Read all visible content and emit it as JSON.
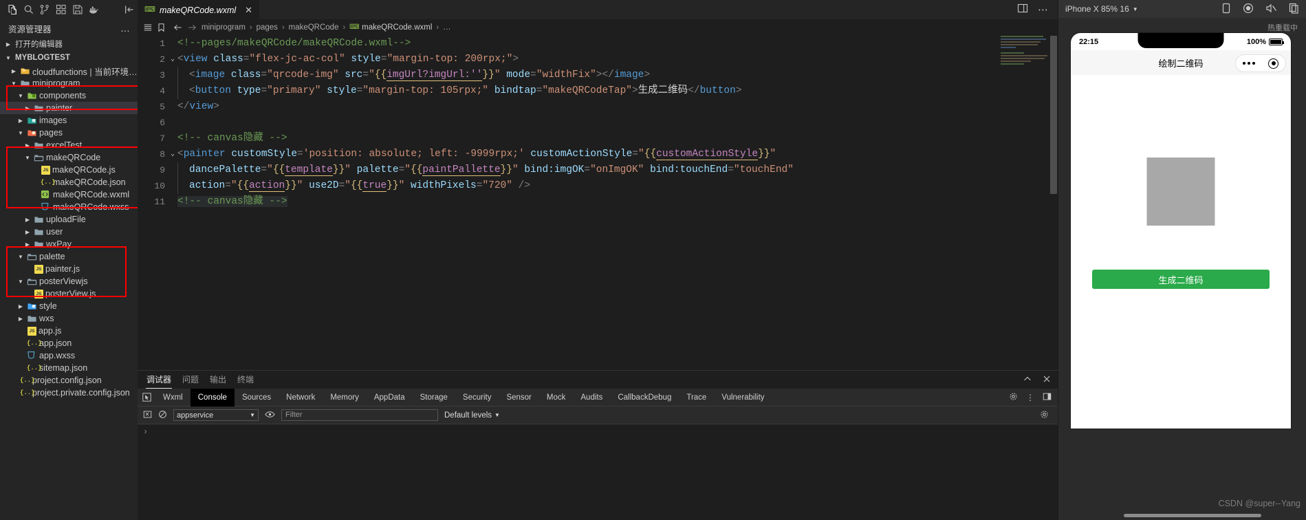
{
  "activity_bar": {
    "icons": [
      "explorer-icon",
      "search-icon",
      "source-control-icon",
      "extensions-icon",
      "save-icon",
      "docker-icon",
      "collapse-icon"
    ]
  },
  "sidebar": {
    "title": "资源管理器",
    "more_label": "…",
    "open_editors_label": "打开的编辑器",
    "project_label": "MYBLOGTEST",
    "tree": [
      {
        "label": "cloudfunctions | 当前环境: blo...",
        "depth": 1,
        "kind": "folder-cloud",
        "twisty": "collapsed"
      },
      {
        "label": "miniprogram",
        "depth": 1,
        "kind": "folder",
        "twisty": "expanded"
      },
      {
        "label": "components",
        "depth": 2,
        "kind": "folder-components",
        "twisty": "expanded"
      },
      {
        "label": "painter",
        "depth": 3,
        "kind": "folder",
        "twisty": "collapsed",
        "selected": true
      },
      {
        "label": "images",
        "depth": 2,
        "kind": "folder-images",
        "twisty": "collapsed"
      },
      {
        "label": "pages",
        "depth": 2,
        "kind": "folder-pages",
        "twisty": "expanded"
      },
      {
        "label": "excelTest",
        "depth": 3,
        "kind": "folder",
        "twisty": "collapsed"
      },
      {
        "label": "makeQRCode",
        "depth": 3,
        "kind": "folder-open",
        "twisty": "expanded"
      },
      {
        "label": "makeQRCode.js",
        "depth": 4,
        "kind": "js",
        "twisty": "none"
      },
      {
        "label": "makeQRCode.json",
        "depth": 4,
        "kind": "json",
        "twisty": "none"
      },
      {
        "label": "makeQRCode.wxml",
        "depth": 4,
        "kind": "wxml",
        "twisty": "none"
      },
      {
        "label": "makeQRCode.wxss",
        "depth": 4,
        "kind": "wxss",
        "twisty": "none"
      },
      {
        "label": "uploadFile",
        "depth": 3,
        "kind": "folder",
        "twisty": "collapsed"
      },
      {
        "label": "user",
        "depth": 3,
        "kind": "folder",
        "twisty": "collapsed"
      },
      {
        "label": "wxPay",
        "depth": 3,
        "kind": "folder",
        "twisty": "collapsed"
      },
      {
        "label": "palette",
        "depth": 2,
        "kind": "folder-open",
        "twisty": "expanded"
      },
      {
        "label": "painter.js",
        "depth": 3,
        "kind": "js",
        "twisty": "none"
      },
      {
        "label": "posterViewjs",
        "depth": 2,
        "kind": "folder-open",
        "twisty": "expanded"
      },
      {
        "label": "posterView.js",
        "depth": 3,
        "kind": "js",
        "twisty": "none"
      },
      {
        "label": "style",
        "depth": 2,
        "kind": "folder-style",
        "twisty": "collapsed"
      },
      {
        "label": "wxs",
        "depth": 2,
        "kind": "folder",
        "twisty": "collapsed"
      },
      {
        "label": "app.js",
        "depth": 2,
        "kind": "js",
        "twisty": "none"
      },
      {
        "label": "app.json",
        "depth": 2,
        "kind": "json",
        "twisty": "none"
      },
      {
        "label": "app.wxss",
        "depth": 2,
        "kind": "wxss",
        "twisty": "none"
      },
      {
        "label": "sitemap.json",
        "depth": 2,
        "kind": "json",
        "twisty": "none"
      },
      {
        "label": "project.config.json",
        "depth": 1,
        "kind": "json",
        "twisty": "none"
      },
      {
        "label": "project.private.config.json",
        "depth": 1,
        "kind": "json",
        "twisty": "none"
      }
    ],
    "highlight_color": "#ff0000"
  },
  "editor": {
    "tab": {
      "label": "makeQRCode.wxml",
      "close": "✕",
      "icon": "wxml-file-icon"
    },
    "actions": [
      "split-editor-icon",
      "more-actions-icon"
    ],
    "breadcrumb": [
      "miniprogram",
      "pages",
      "makeQRCode",
      "makeQRCode.wxml",
      "…"
    ],
    "lines": [
      {
        "n": 1,
        "fold": "",
        "indent": 0,
        "tokens": [
          {
            "t": "<!--pages/makeQRCode/makeQRCode.wxml-->",
            "c": "t-comment"
          }
        ]
      },
      {
        "n": 2,
        "fold": "⌄",
        "indent": 0,
        "tokens": [
          {
            "t": "<",
            "c": "t-punc"
          },
          {
            "t": "view",
            "c": "t-tag"
          },
          {
            "t": " ",
            "c": "t-white"
          },
          {
            "t": "class",
            "c": "t-attr"
          },
          {
            "t": "=",
            "c": "t-punc"
          },
          {
            "t": "\"flex-jc-ac-col\"",
            "c": "t-str"
          },
          {
            "t": " ",
            "c": "t-white"
          },
          {
            "t": "style",
            "c": "t-attr"
          },
          {
            "t": "=",
            "c": "t-punc"
          },
          {
            "t": "\"margin-top: 200rpx;\"",
            "c": "t-str"
          },
          {
            "t": ">",
            "c": "t-punc"
          }
        ]
      },
      {
        "n": 3,
        "fold": "",
        "indent": 1,
        "tokens": [
          {
            "t": "<",
            "c": "t-punc"
          },
          {
            "t": "image",
            "c": "t-tag"
          },
          {
            "t": " ",
            "c": "t-white"
          },
          {
            "t": "class",
            "c": "t-attr"
          },
          {
            "t": "=",
            "c": "t-punc"
          },
          {
            "t": "\"qrcode-img\"",
            "c": "t-str"
          },
          {
            "t": " ",
            "c": "t-white"
          },
          {
            "t": "src",
            "c": "t-attr"
          },
          {
            "t": "=",
            "c": "t-punc"
          },
          {
            "t": "\"",
            "c": "t-str"
          },
          {
            "t": "{{",
            "c": "t-brace"
          },
          {
            "t": "imgUrl?imgUrl:''",
            "c": "t-mus"
          },
          {
            "t": "}}",
            "c": "t-brace"
          },
          {
            "t": "\"",
            "c": "t-str"
          },
          {
            "t": " ",
            "c": "t-white"
          },
          {
            "t": "mode",
            "c": "t-attr"
          },
          {
            "t": "=",
            "c": "t-punc"
          },
          {
            "t": "\"widthFix\"",
            "c": "t-str"
          },
          {
            "t": ">",
            "c": "t-punc"
          },
          {
            "t": "</",
            "c": "t-punc"
          },
          {
            "t": "image",
            "c": "t-tag"
          },
          {
            "t": ">",
            "c": "t-punc"
          }
        ]
      },
      {
        "n": 4,
        "fold": "",
        "indent": 1,
        "tokens": [
          {
            "t": "<",
            "c": "t-punc"
          },
          {
            "t": "button",
            "c": "t-tag"
          },
          {
            "t": " ",
            "c": "t-white"
          },
          {
            "t": "type",
            "c": "t-attr"
          },
          {
            "t": "=",
            "c": "t-punc"
          },
          {
            "t": "\"primary\"",
            "c": "t-str"
          },
          {
            "t": " ",
            "c": "t-white"
          },
          {
            "t": "style",
            "c": "t-attr"
          },
          {
            "t": "=",
            "c": "t-punc"
          },
          {
            "t": "\"margin-top: 105rpx;\"",
            "c": "t-str"
          },
          {
            "t": " ",
            "c": "t-white"
          },
          {
            "t": "bindtap",
            "c": "t-attr"
          },
          {
            "t": "=",
            "c": "t-punc"
          },
          {
            "t": "\"makeQRCodeTap\"",
            "c": "t-str"
          },
          {
            "t": ">",
            "c": "t-punc"
          },
          {
            "t": "生成二维码",
            "c": "t-white"
          },
          {
            "t": "</",
            "c": "t-punc"
          },
          {
            "t": "button",
            "c": "t-tag"
          },
          {
            "t": ">",
            "c": "t-punc"
          }
        ]
      },
      {
        "n": 5,
        "fold": "",
        "indent": 0,
        "tokens": [
          {
            "t": "</",
            "c": "t-punc"
          },
          {
            "t": "view",
            "c": "t-tag"
          },
          {
            "t": ">",
            "c": "t-punc"
          }
        ]
      },
      {
        "n": 6,
        "fold": "",
        "indent": 0,
        "tokens": []
      },
      {
        "n": 7,
        "fold": "",
        "indent": 0,
        "tokens": [
          {
            "t": "<!-- canvas隐藏 -->",
            "c": "t-comment"
          }
        ]
      },
      {
        "n": 8,
        "fold": "⌄",
        "indent": 0,
        "tokens": [
          {
            "t": "<",
            "c": "t-punc"
          },
          {
            "t": "painter",
            "c": "t-tag"
          },
          {
            "t": " ",
            "c": "t-white"
          },
          {
            "t": "customStyle",
            "c": "t-attr"
          },
          {
            "t": "=",
            "c": "t-punc"
          },
          {
            "t": "'position: absolute; left: -9999rpx;'",
            "c": "t-str"
          },
          {
            "t": " ",
            "c": "t-white"
          },
          {
            "t": "customActionStyle",
            "c": "t-attr"
          },
          {
            "t": "=",
            "c": "t-punc"
          },
          {
            "t": "\"",
            "c": "t-str"
          },
          {
            "t": "{{",
            "c": "t-brace"
          },
          {
            "t": "customActionStyle",
            "c": "t-mus"
          },
          {
            "t": "}}",
            "c": "t-brace"
          },
          {
            "t": "\"",
            "c": "t-str"
          }
        ]
      },
      {
        "n": 9,
        "fold": "",
        "indent": 1,
        "tokens": [
          {
            "t": "dancePalette",
            "c": "t-attr"
          },
          {
            "t": "=",
            "c": "t-punc"
          },
          {
            "t": "\"",
            "c": "t-str"
          },
          {
            "t": "{{",
            "c": "t-brace"
          },
          {
            "t": "template",
            "c": "t-mus"
          },
          {
            "t": "}}",
            "c": "t-brace"
          },
          {
            "t": "\"",
            "c": "t-str"
          },
          {
            "t": " ",
            "c": "t-white"
          },
          {
            "t": "palette",
            "c": "t-attr"
          },
          {
            "t": "=",
            "c": "t-punc"
          },
          {
            "t": "\"",
            "c": "t-str"
          },
          {
            "t": "{{",
            "c": "t-brace"
          },
          {
            "t": "paintPallette",
            "c": "t-mus"
          },
          {
            "t": "}}",
            "c": "t-brace"
          },
          {
            "t": "\"",
            "c": "t-str"
          },
          {
            "t": " ",
            "c": "t-white"
          },
          {
            "t": "bind:imgOK",
            "c": "t-attr"
          },
          {
            "t": "=",
            "c": "t-punc"
          },
          {
            "t": "\"onImgOK\"",
            "c": "t-str"
          },
          {
            "t": " ",
            "c": "t-white"
          },
          {
            "t": "bind:touchEnd",
            "c": "t-attr"
          },
          {
            "t": "=",
            "c": "t-punc"
          },
          {
            "t": "\"touchEnd\"",
            "c": "t-str"
          }
        ]
      },
      {
        "n": 10,
        "fold": "",
        "indent": 1,
        "tokens": [
          {
            "t": "action",
            "c": "t-attr"
          },
          {
            "t": "=",
            "c": "t-punc"
          },
          {
            "t": "\"",
            "c": "t-str"
          },
          {
            "t": "{{",
            "c": "t-brace"
          },
          {
            "t": "action",
            "c": "t-mus"
          },
          {
            "t": "}}",
            "c": "t-brace"
          },
          {
            "t": "\"",
            "c": "t-str"
          },
          {
            "t": " ",
            "c": "t-white"
          },
          {
            "t": "use2D",
            "c": "t-attr"
          },
          {
            "t": "=",
            "c": "t-punc"
          },
          {
            "t": "\"",
            "c": "t-str"
          },
          {
            "t": "{{",
            "c": "t-brace"
          },
          {
            "t": "true",
            "c": "t-mus"
          },
          {
            "t": "}}",
            "c": "t-brace"
          },
          {
            "t": "\"",
            "c": "t-str"
          },
          {
            "t": " ",
            "c": "t-white"
          },
          {
            "t": "widthPixels",
            "c": "t-attr"
          },
          {
            "t": "=",
            "c": "t-punc"
          },
          {
            "t": "\"720\"",
            "c": "t-str"
          },
          {
            "t": " />",
            "c": "t-punc"
          }
        ]
      },
      {
        "n": 11,
        "fold": "",
        "indent": 0,
        "highlight": true,
        "tokens": [
          {
            "t": "<!-- canvas隐藏 -->",
            "c": "t-comment"
          }
        ]
      }
    ]
  },
  "panel": {
    "tabs": [
      {
        "label": "调试器",
        "active": true
      },
      {
        "label": "问题",
        "active": false
      },
      {
        "label": "输出",
        "active": false
      },
      {
        "label": "终端",
        "active": false
      }
    ],
    "actions": [
      "chevron-up-icon",
      "close-icon"
    ],
    "devtools_tabs": [
      {
        "label": "Wxml",
        "active": false
      },
      {
        "label": "Console",
        "active": true
      },
      {
        "label": "Sources",
        "active": false
      },
      {
        "label": "Network",
        "active": false
      },
      {
        "label": "Memory",
        "active": false
      },
      {
        "label": "AppData",
        "active": false
      },
      {
        "label": "Storage",
        "active": false
      },
      {
        "label": "Security",
        "active": false
      },
      {
        "label": "Sensor",
        "active": false
      },
      {
        "label": "Mock",
        "active": false
      },
      {
        "label": "Audits",
        "active": false
      },
      {
        "label": "CallbackDebug",
        "active": false
      },
      {
        "label": "Trace",
        "active": false
      },
      {
        "label": "Vulnerability",
        "active": false
      }
    ],
    "devtools_right_icons": [
      "settings-gear-icon",
      "more-vertical-icon",
      "dock-icon"
    ],
    "console": {
      "clear_icon": "clear-console-icon",
      "block_icon": "no-entry-icon",
      "context": "appservice",
      "eye_icon": "eye-icon",
      "filter_placeholder": "Filter",
      "levels_label": "Default levels",
      "gear_icon": "console-settings-icon",
      "prompt": "›"
    }
  },
  "simulator": {
    "device_label": "iPhone X 85% 16",
    "top_icons": [
      "device-rotate-icon",
      "record-icon",
      "mute-icon",
      "copy-icon",
      "more-icon"
    ],
    "hot_reload_label": "热重载中",
    "status_time": "22:15",
    "battery_pct": "100%",
    "nav_title": "绘制二维码",
    "capsule_icons": [
      "more-dots-icon",
      "target-icon"
    ],
    "button_label": "生成二维码",
    "button_color": "#2aaa4a",
    "image_placeholder_color": "#a8a8a8",
    "watermark": "CSDN @super--Yang"
  }
}
